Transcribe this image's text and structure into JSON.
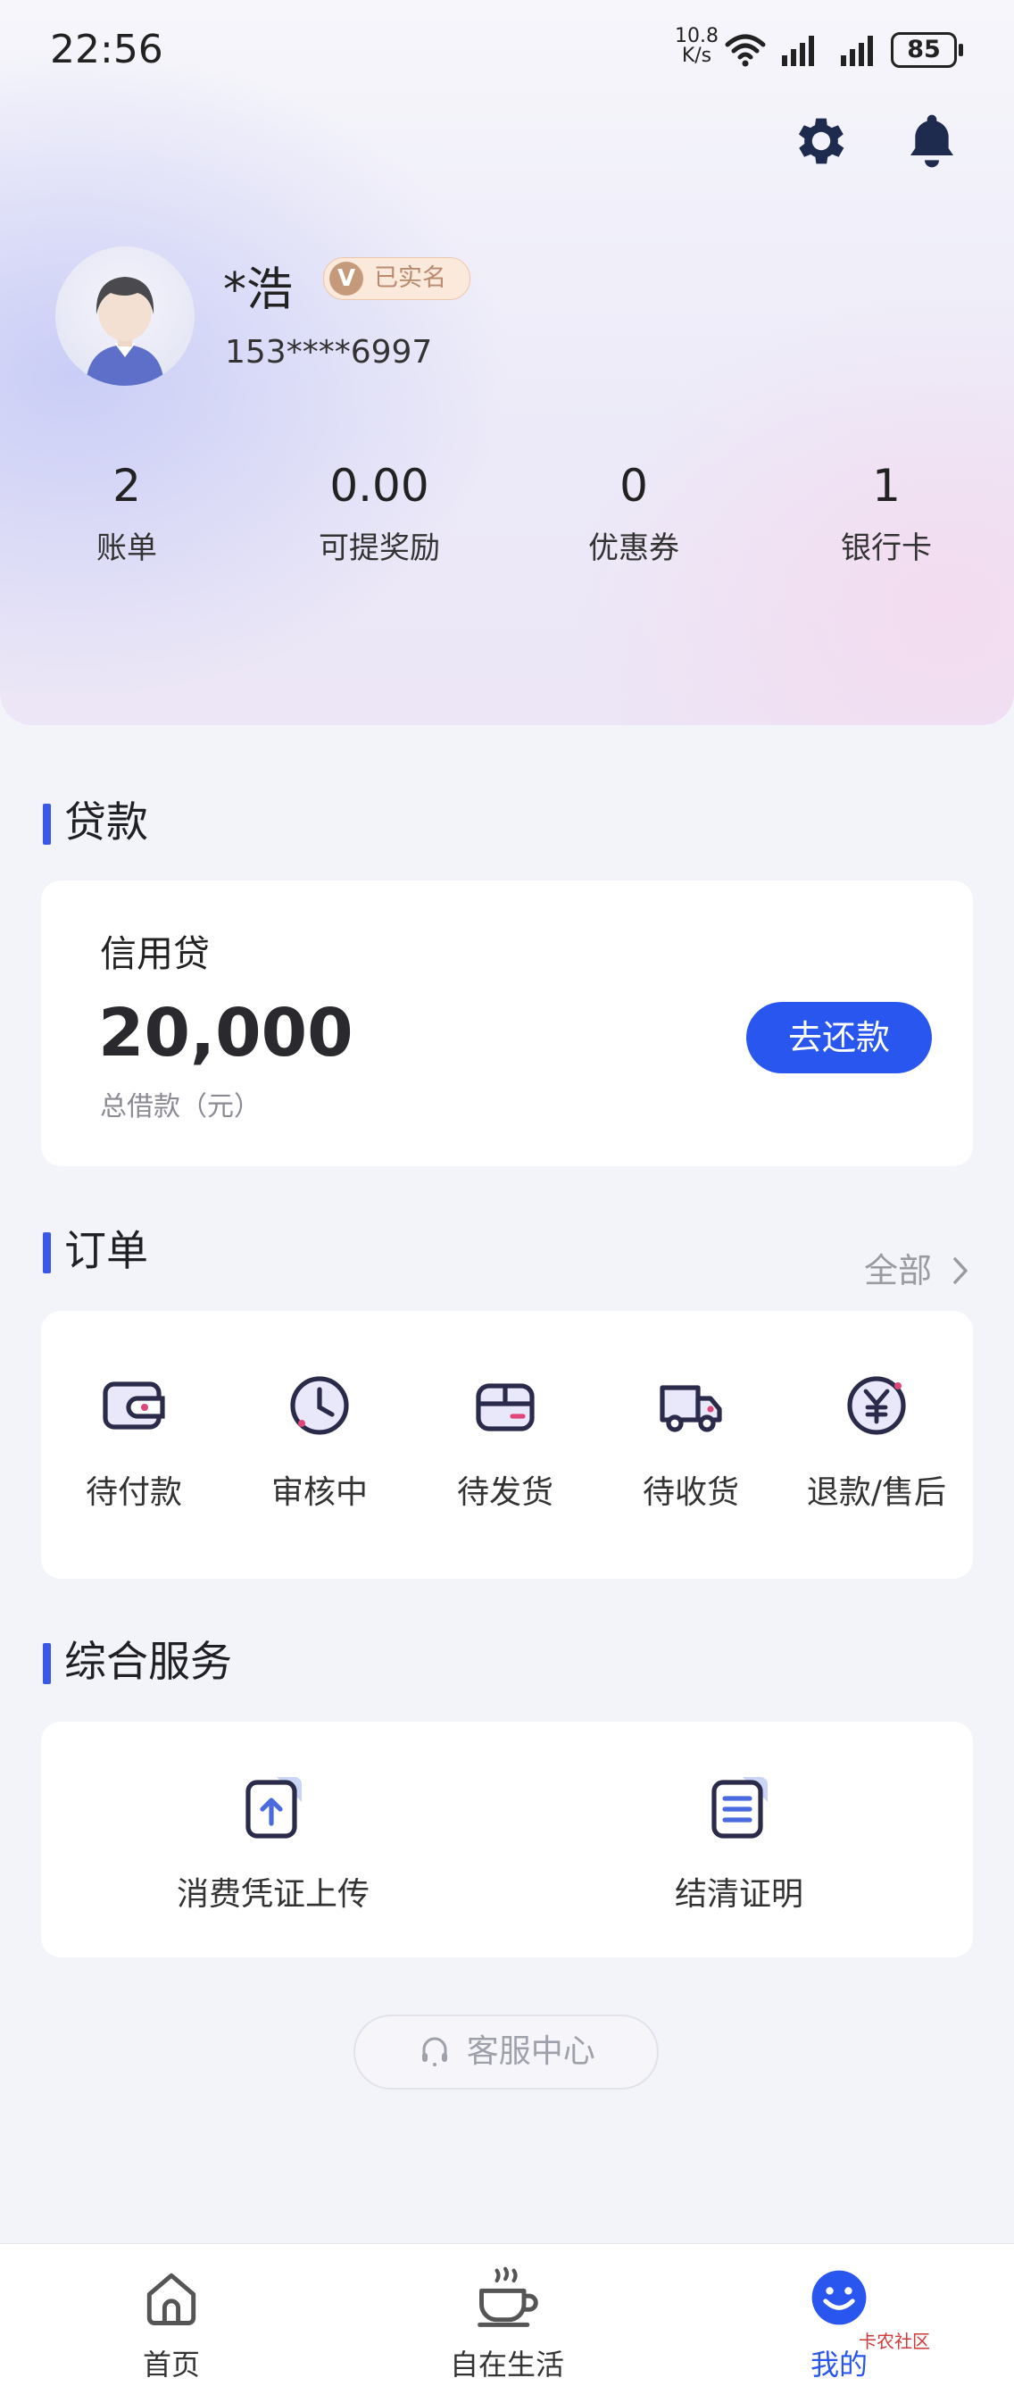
{
  "status_bar": {
    "time": "22:56",
    "speed_value": "10.8",
    "speed_unit": "K/s",
    "battery": "85"
  },
  "header": {
    "settings_icon": "gear-icon",
    "notification_icon": "bell-icon"
  },
  "profile": {
    "name": "*浩",
    "verified_badge": "已实名",
    "verified_mark": "V",
    "phone": "153****6997"
  },
  "stats": [
    {
      "value": "2",
      "label": "账单"
    },
    {
      "value": "0.00",
      "label": "可提奖励"
    },
    {
      "value": "0",
      "label": "优惠券"
    },
    {
      "value": "1",
      "label": "银行卡"
    }
  ],
  "loan": {
    "section_title": "贷款",
    "type": "信用贷",
    "amount": "20,000",
    "caption": "总借款（元）",
    "repay_button": "去还款"
  },
  "orders": {
    "section_title": "订单",
    "all_link": "全部",
    "items": [
      {
        "label": "待付款",
        "icon": "wallet-icon"
      },
      {
        "label": "审核中",
        "icon": "clock-icon"
      },
      {
        "label": "待发货",
        "icon": "package-icon"
      },
      {
        "label": "待收货",
        "icon": "truck-icon"
      },
      {
        "label": "退款/售后",
        "icon": "refund-yen-icon"
      }
    ]
  },
  "services": {
    "section_title": "综合服务",
    "items": [
      {
        "label": "消费凭证上传",
        "icon": "upload-document-icon"
      },
      {
        "label": "结清证明",
        "icon": "certificate-document-icon"
      }
    ]
  },
  "customer_service": {
    "label": "客服中心",
    "icon": "headset-icon"
  },
  "bottom_nav": [
    {
      "label": "首页",
      "icon": "home-icon"
    },
    {
      "label": "自在生活",
      "icon": "coffee-cup-icon"
    },
    {
      "label": "我的",
      "icon": "smiley-icon"
    }
  ],
  "watermark": "卡农社区",
  "colors": {
    "accent": "#2a56f0",
    "section_bar": "#3a58e6",
    "page_bg": "#f3f4f9",
    "badge_bg": "#fbe9dc"
  }
}
